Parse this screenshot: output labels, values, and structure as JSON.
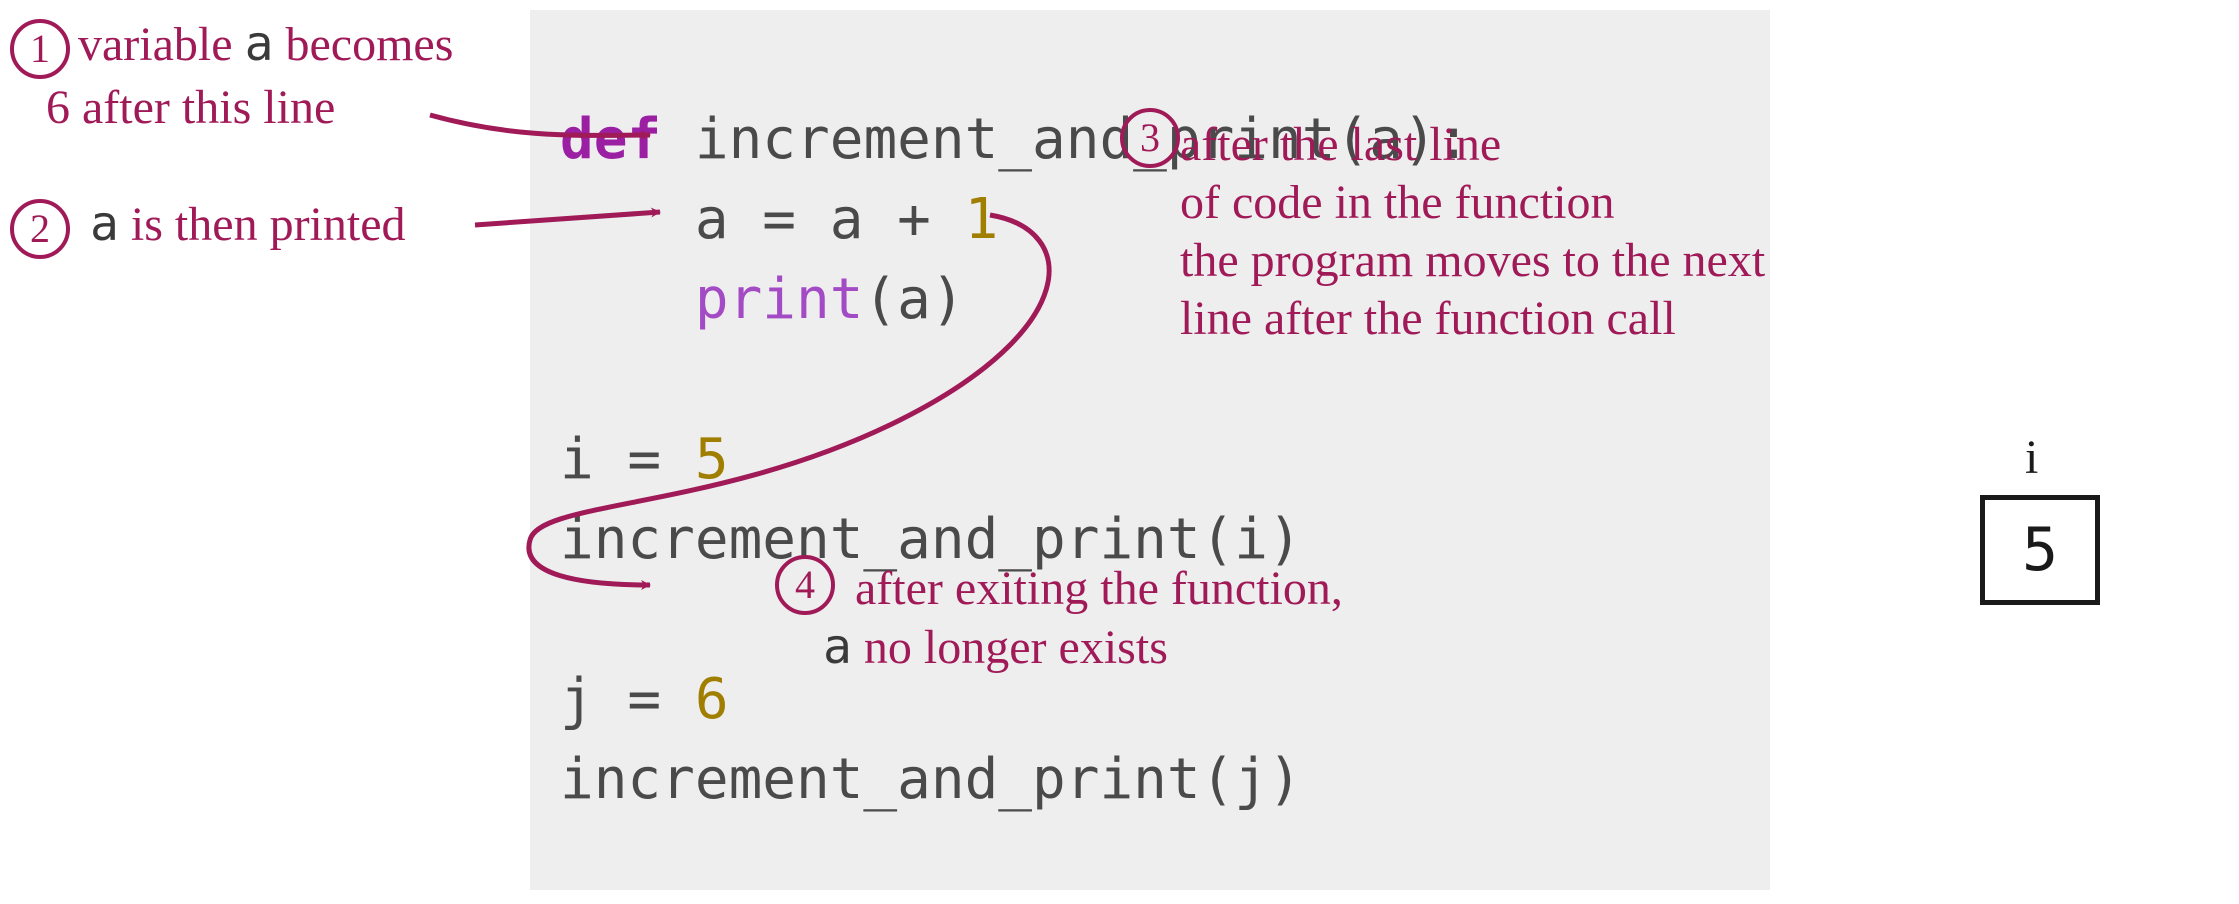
{
  "code": {
    "line1_pre": "def",
    "line1_post": " increment_and_print(a):",
    "line2_pre": "    a = a + ",
    "line2_num": "1",
    "line3_pre": "    ",
    "line3_func": "print",
    "line3_post": "(a)",
    "blank1": "",
    "line5_pre": "i = ",
    "line5_num": "5",
    "line6": "increment_and_print(i)",
    "blank2": "",
    "line8_pre": "j = ",
    "line8_num": "6",
    "line9": "increment_and_print(j)"
  },
  "annot": {
    "n1_num": "1",
    "n1_a": "variable ",
    "n1_b": "a",
    "n1_c": " becomes",
    "n1_d": "6 after this line",
    "n2_num": "2",
    "n2_a": "a",
    "n2_b": " is then printed",
    "n3_num": "3",
    "n3_a": "after the last line",
    "n3_b": "of code in the function",
    "n3_c": "the program moves to the next",
    "n3_d": "line after the function call",
    "n4_num": "4",
    "n4_a": " after exiting the function,",
    "n4_b": "a",
    "n4_c": " no longer exists"
  },
  "memory": {
    "i_label": "i",
    "i_value": "5"
  },
  "colors": {
    "annotation": "#a01a58",
    "code_bg": "#eeeeef",
    "keyword": "#9b1fa3",
    "number": "#a07e00",
    "builtin": "#a34bc5",
    "text": "#4a4a4a"
  }
}
